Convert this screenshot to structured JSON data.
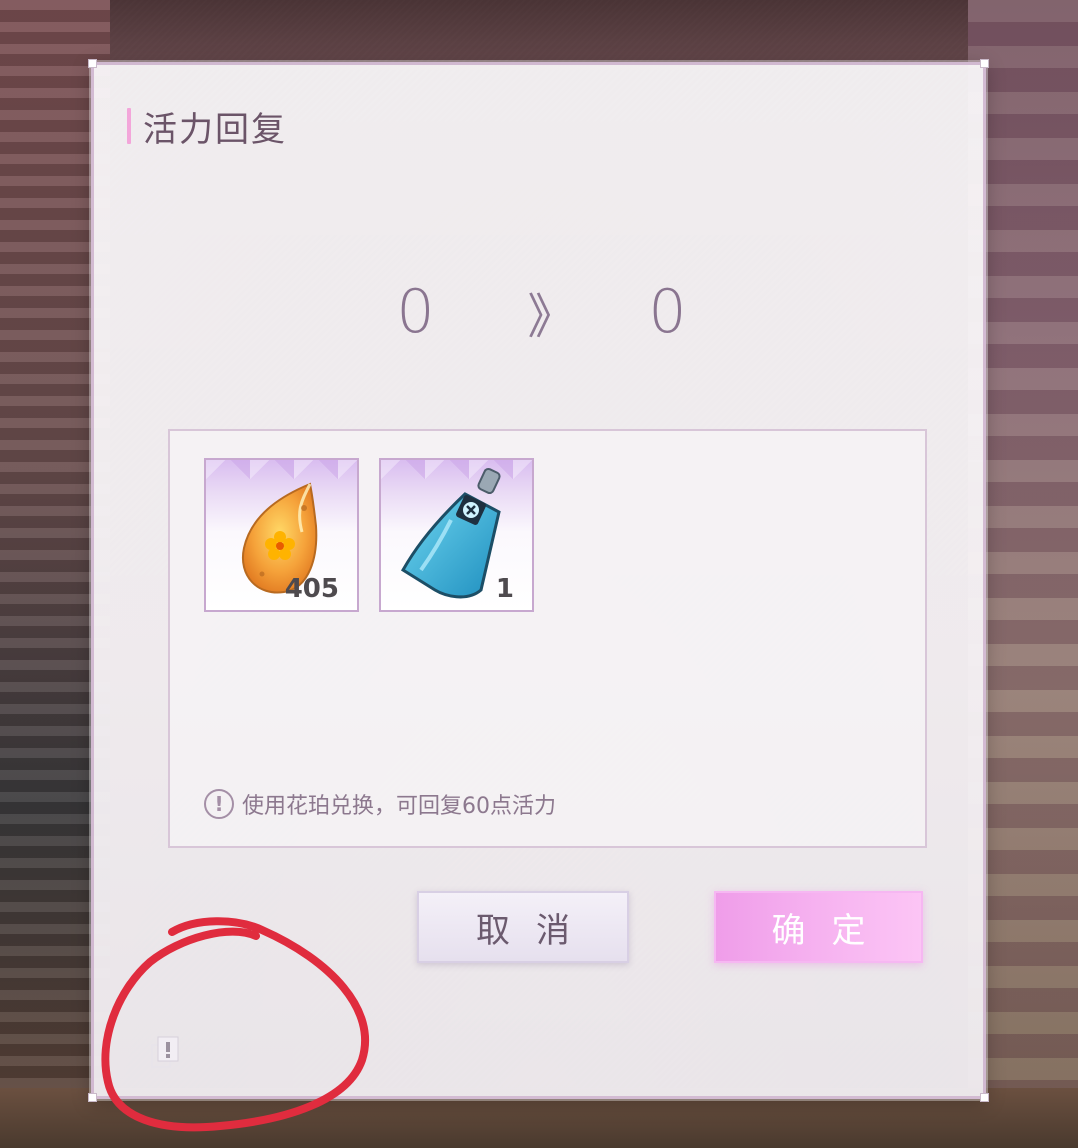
{
  "dialog": {
    "title": "活力回复",
    "vitality_from": "0",
    "vitality_arrow": "》",
    "vitality_to": "0",
    "items": [
      {
        "name": "amber-flower-item",
        "count": "405"
      },
      {
        "name": "blue-pouch-item",
        "count": "1"
      }
    ],
    "hint_icon": "!",
    "hint_text": "使用花珀兑换，可回复60点活力",
    "cancel_label": "取消",
    "confirm_label": "确定"
  },
  "colors": {
    "accent": "#f3a6da",
    "confirm_button": "#f6b2f0",
    "annotation_circle": "#e02c3e"
  },
  "icons": {
    "corner_tool": "copy-alert-icon"
  }
}
